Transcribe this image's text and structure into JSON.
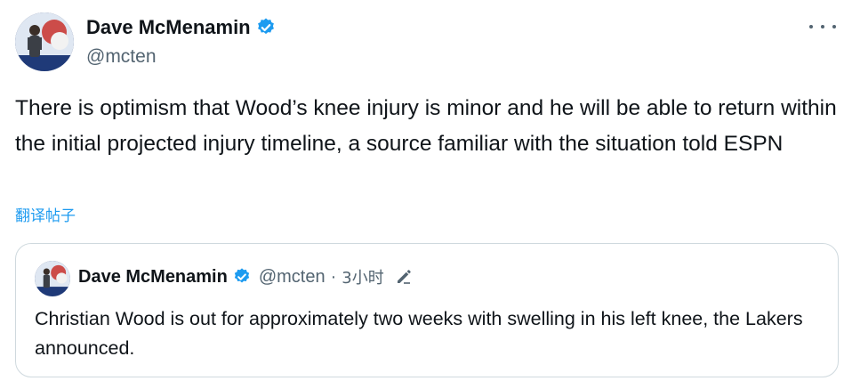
{
  "author": {
    "display_name": "Dave McMenamin",
    "handle": "@mcten"
  },
  "tweet": {
    "text": "There is optimism that Wood’s knee injury is minor and he will be able to return within the initial projected injury timeline, a source familiar with the situation told ESPN",
    "translate_label": "翻译帖子"
  },
  "quoted": {
    "display_name": "Dave McMenamin",
    "handle": "@mcten",
    "separator": "·",
    "time": "3小时",
    "text": "Christian Wood is out for approximately two weeks with swelling in his left knee, the Lakers announced."
  },
  "icons": {
    "verified": "verified-badge-icon",
    "more": "more-dots-icon",
    "edit": "edited-pencil-icon"
  },
  "colors": {
    "text": "#0f1419",
    "secondary": "#536471",
    "accent": "#1d9bf0",
    "border": "#cfd9de"
  }
}
